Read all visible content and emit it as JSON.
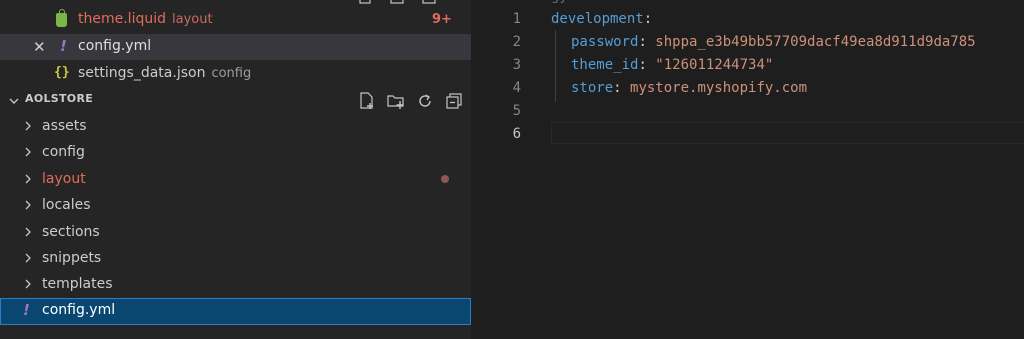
{
  "open_editors": [
    {
      "name": "theme.liquid",
      "description": "layout",
      "badge": "9+"
    },
    {
      "name": "config.yml",
      "description": ""
    },
    {
      "name": "settings_data.json",
      "description": "config"
    }
  ],
  "explorer": {
    "title": "AOLSTORE",
    "folders": [
      "assets",
      "config",
      "layout",
      "locales",
      "sections",
      "snippets",
      "templates"
    ],
    "active_file": "config.yml"
  },
  "editor": {
    "line_numbers": [
      "1",
      "2",
      "3",
      "4",
      "5",
      "6"
    ],
    "lines": [
      {
        "key": "development",
        "colon": ":",
        "value": ""
      },
      {
        "key": "password",
        "colon": ": ",
        "value": "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"
      },
      {
        "key": "theme_id",
        "colon": ": ",
        "value": "\"126011244734\""
      },
      {
        "key": "store",
        "colon": ": ",
        "value": "mystore.myshopify.com"
      }
    ]
  },
  "colors": {
    "modified": "#e06c5a",
    "yaml_key": "#569cd6",
    "yaml_value": "#ce9178",
    "selection": "#094771"
  }
}
